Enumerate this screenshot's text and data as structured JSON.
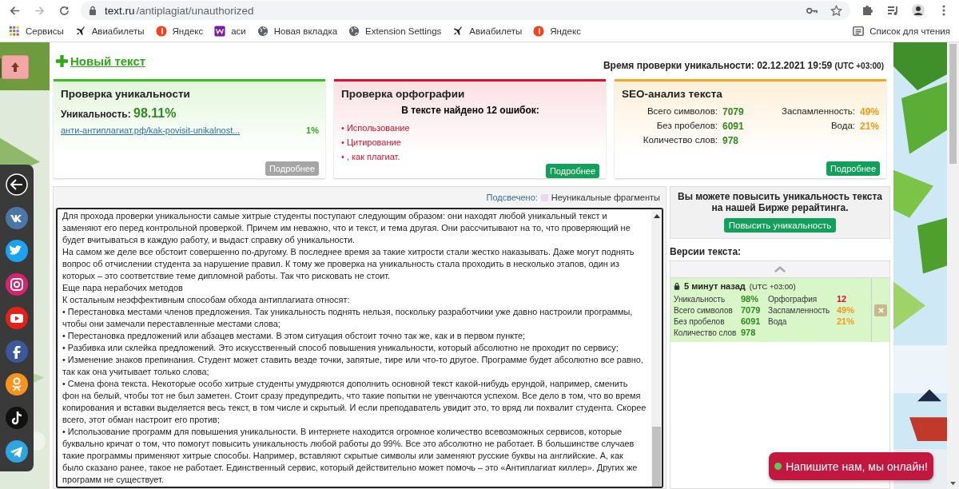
{
  "browser": {
    "url_host": "text.ru",
    "url_path": "/antiplagiat/unauthorized",
    "bookmarks": [
      {
        "label": "Сервисы",
        "kind": "apps"
      },
      {
        "label": "Авиабилеты",
        "kind": "plane"
      },
      {
        "label": "Яндекс",
        "kind": "yandex"
      },
      {
        "label": "аси",
        "kind": "w"
      },
      {
        "label": "Новая вкладка",
        "kind": "globe"
      },
      {
        "label": "Extension Settings",
        "kind": "globe"
      },
      {
        "label": "Авиабилеты",
        "kind": "plane"
      },
      {
        "label": "Яндекс",
        "kind": "yandex"
      }
    ],
    "reading_list": "Список для чтения"
  },
  "new_text_link": "Новый текст",
  "check_time": {
    "label": "Время проверки уникальности: 02.12.2021 19:59",
    "tz": "(UTC +03:00)"
  },
  "cards": [
    {
      "kind": "uniqueness",
      "title": "Проверка уникальности",
      "uniqueness_label": "Уникальность:",
      "uniqueness_value": "98.11%",
      "source_link": "анти-антиплагиат.рф/kak-povisit-unikalnost...",
      "source_percent": "1%",
      "button": "Подробнее",
      "button_disabled": true
    },
    {
      "kind": "spelling",
      "title": "Проверка орфографии",
      "summary": "В тексте найдено 12 ошибок:",
      "errors": [
        "• Использование",
        "• Цитирование",
        "• , как плагиат."
      ],
      "button": "Подробнее",
      "button_disabled": false
    },
    {
      "kind": "seo",
      "title": "SEO-анализ текста",
      "stats": [
        {
          "label": "Всего символов:",
          "value": "7079",
          "color": "#2e8b1e"
        },
        {
          "label": "Заспамленность:",
          "value": "49%",
          "color": "#f59a14"
        },
        {
          "label": "Без пробелов:",
          "value": "6091",
          "color": "#2e8b1e"
        },
        {
          "label": "Вода:",
          "value": "21%",
          "color": "#f59a14"
        },
        {
          "label": "Количество слов:",
          "value": "978",
          "color": "#2e8b1e"
        }
      ],
      "button": "Подробнее",
      "button_disabled": false
    }
  ],
  "highlight": {
    "label": "Подсвечено:",
    "legend": "Неуникальные фрагменты"
  },
  "text": [
    "Для прохода проверки уникальности самые хитрые студенты поступают следующим образом: они находят любой уникальный текст и заменяют его перед контрольной проверкой. Причем им неважно, что и текст, и тема другая. Они рассчитывают на то, что проверяющий не будет вчитываться в каждую работу, и выдаст справку об уникальности.",
    "На самом же деле все обстоит совершенно по-другому. В последнее время за такие хитрости стали жестко наказывать. Даже могут поднять вопрос об отчислении студента за нарушение правил. К тому же проверка на уникальность стала проходить в несколько этапов, один из которых – это соответствие теме дипломной работы. Так что рисковать не стоит.",
    "Еще пара нерабочих методов",
    "К остальным неэффективным способам обхода антиплагиата относят:",
    "• Перестановка местами членов предложения. Так уникальность поднять нельзя, поскольку разработчики уже давно настроили программы, чтобы они замечали переставленные местами слова;",
    "• Перестановка предложений или абзацев местами. В этом ситуация обстоит точно так же, как и в первом пункте;",
    "• Разбивка или склейка предложений. Это искусственный способ повышения уникальности, который абсолютно не проходит по сервису;",
    "• Изменение знаков препинания. Студент может ставить везде точки, запятые, тире или что-то другое. Программе будет абсолютно все равно, так как она учитывает только слова;",
    "• Смена фона текста. Некоторые особо хитрые студенты умудряются дополнить основной текст какой-нибудь ерундой, например, сменить фон на белый, чтобы тот не был заметен. Стоит сразу предупредить, что такие попытки не увенчаются успехом. Все дело в том, что во время копирования и вставки выделяется весь текст, в том числе и скрытый. И если преподаватель увидит это, то вряд ли похвалит студента. Скорее всего, этот обман настроит его против;",
    "• Использование программ для повышения уникальности. В интернете находится огромное количество всевозможных сервисов, которые буквально кричат о том, что помогут повысить уникальность любой работы до 99%. Все это абсолютно не работает. В большинстве случаев такие программы применяют хитрые способы. Например, вставляют скрытые символы или заменяют русские буквы на английские. А, как было сказано ранее, такое не работает. Единственный сервис, который действительно может помочь – это «Антиплагиат киллер». Других же программ не существует."
  ],
  "promo": {
    "text": "Вы можете повысить уникальность текста на нашей Бирже рерайтинга.",
    "button": "Повысить уникальность"
  },
  "versions": {
    "title": "Версии текста:",
    "items": [
      {
        "time": "5 минут назад",
        "tz": "(UTC +03:00)",
        "selected": true,
        "stats": [
          {
            "label": "Уникальность",
            "value": "98%",
            "color": "#2e8b1e"
          },
          {
            "label": "Орфография",
            "value": "12",
            "color": "#e0102a"
          },
          {
            "label": "Всего символов",
            "value": "7079",
            "color": "#2e8b1e"
          },
          {
            "label": "Заспамленность",
            "value": "49%",
            "color": "#f59a14"
          },
          {
            "label": "Без пробелов",
            "value": "6091",
            "color": "#2e8b1e"
          },
          {
            "label": "Вода",
            "value": "21%",
            "color": "#f59a14"
          },
          {
            "label": "Количество слов",
            "value": "978",
            "color": "#2e8b1e"
          }
        ]
      }
    ]
  },
  "social": [
    {
      "kind": "back",
      "color": "#222222"
    },
    {
      "kind": "vk",
      "color": "#4a76a8"
    },
    {
      "kind": "twitter",
      "color": "#1da1f2"
    },
    {
      "kind": "instagram",
      "color": "#d6246e"
    },
    {
      "kind": "youtube",
      "color": "#e62117"
    },
    {
      "kind": "facebook",
      "color": "#3b5998"
    },
    {
      "kind": "ok",
      "color": "#f7931e"
    },
    {
      "kind": "tiktok",
      "color": "#111111"
    },
    {
      "kind": "telegram",
      "color": "#2ca5e0"
    }
  ],
  "chat_button": "Напишите нам, мы онлайн!"
}
